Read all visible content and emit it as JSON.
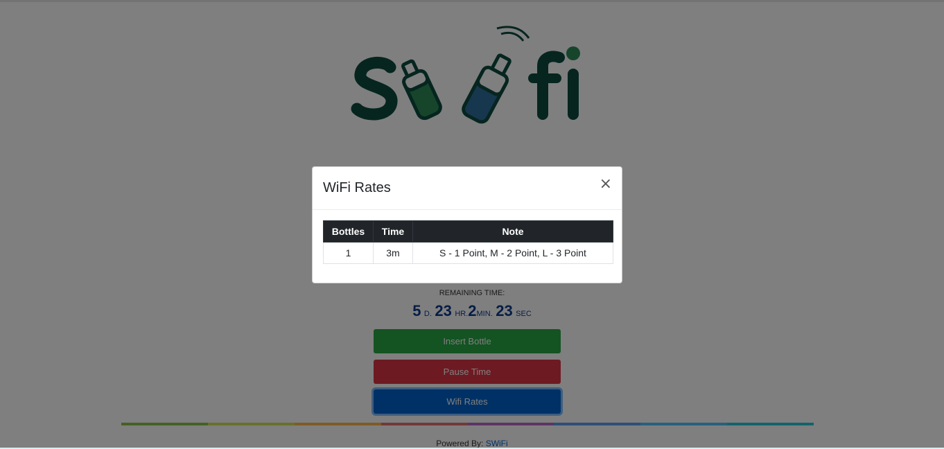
{
  "logo": {
    "text": "SWifi"
  },
  "remaining": {
    "label": "REMAINING TIME:",
    "days": "5",
    "days_unit": "D.",
    "hours": "23",
    "hours_unit": "HR.",
    "minutes": "2",
    "minutes_unit": "MIN.",
    "seconds": "23",
    "seconds_unit": "SEC"
  },
  "buttons": {
    "insert_bottle": "Insert Bottle",
    "pause_time": "Pause Time",
    "wifi_rates": "Wifi Rates"
  },
  "footer": {
    "powered_by": "Powered By:",
    "brand": "SWiFi"
  },
  "modal": {
    "title": "WiFi Rates",
    "close": "×",
    "table": {
      "headers": [
        "Bottles",
        "Time",
        "Note"
      ],
      "rows": [
        [
          "1",
          "3m",
          "S - 1 Point, M - 2 Point, L - 3 Point"
        ]
      ]
    }
  },
  "colors": {
    "primary": "#0062cc",
    "success": "#28a745",
    "danger": "#dc3545",
    "logo": "#0d4a3e",
    "rainbow": [
      "#8bc34a",
      "#d4e157",
      "#ffb74d",
      "#e57373",
      "#ba68c8",
      "#5c9ded",
      "#4fc3f7",
      "#26c6da"
    ]
  }
}
